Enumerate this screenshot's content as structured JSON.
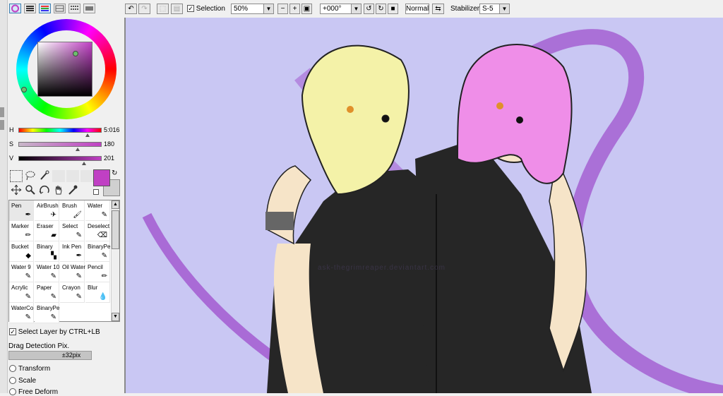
{
  "color_panel": {
    "modes": [
      "color-wheel-icon",
      "rgb-sliders-icon",
      "hsv-sliders-icon",
      "palette-icon",
      "swatches-icon",
      "scratchpad-icon"
    ],
    "sliders": [
      {
        "key": "H",
        "value": "5:016",
        "level": 0.83
      },
      {
        "key": "S",
        "value": "180",
        "level": 0.71
      },
      {
        "key": "V",
        "value": "201",
        "level": 0.79
      }
    ],
    "foreground_color": "#c040c4",
    "background_color": "#d0d0d0"
  },
  "tools": [
    "marquee-icon",
    "lasso-icon",
    "magic-wand-icon",
    "move-icon",
    "zoom-icon",
    "rotate-icon",
    "hand-icon",
    "eyedropper-icon"
  ],
  "brushes": [
    {
      "label": "Pen",
      "icon": "pen-icon"
    },
    {
      "label": "AirBrush",
      "icon": "airbrush-icon"
    },
    {
      "label": "Brush",
      "icon": "brush-icon"
    },
    {
      "label": "Water",
      "icon": "water-icon"
    },
    {
      "label": "Marker",
      "icon": "marker-icon"
    },
    {
      "label": "Eraser",
      "icon": "eraser-icon"
    },
    {
      "label": "Select",
      "icon": "select-pen-icon"
    },
    {
      "label": "Deselect",
      "icon": "deselect-icon"
    },
    {
      "label": "Bucket",
      "icon": "bucket-icon"
    },
    {
      "label": "Binary",
      "icon": "binary-icon"
    },
    {
      "label": "Ink Pen",
      "icon": "ink-pen-icon"
    },
    {
      "label": "BinaryPe",
      "icon": "binary-pen-icon"
    },
    {
      "label": "Water 9",
      "icon": "water-icon"
    },
    {
      "label": "Water 10",
      "icon": "water-icon"
    },
    {
      "label": "Oil Water",
      "icon": "oil-water-icon"
    },
    {
      "label": "Pencil",
      "icon": "pencil-icon"
    },
    {
      "label": "Acrylic",
      "icon": "acrylic-icon"
    },
    {
      "label": "Paper",
      "icon": "paper-icon"
    },
    {
      "label": "Crayon",
      "icon": "crayon-icon"
    },
    {
      "label": "Blur",
      "icon": "blur-icon"
    },
    {
      "label": "WaterCo",
      "icon": "watercolor-icon"
    },
    {
      "label": "BinaryPe",
      "icon": "binary-pen-icon"
    }
  ],
  "options": {
    "select_layer_label": "Select Layer by CTRL+LB",
    "select_layer_checked": true,
    "drag_detection_label": "Drag Detection Pix.",
    "drag_detection_value": "±32pix",
    "transform_modes": [
      "Transform",
      "Scale",
      "Free Deform"
    ]
  },
  "toolbar": {
    "selection_label": "Selection",
    "selection_checked": true,
    "zoom_value": "50%",
    "rotation_value": "+000°",
    "blend_mode": "Normal",
    "stabilizer_label": "Stabilizer",
    "stabilizer_value": "S-5"
  },
  "canvas": {
    "background_color": "#c9c7f3",
    "watermark": "ask-thegrimreaper.deviantart.com"
  }
}
